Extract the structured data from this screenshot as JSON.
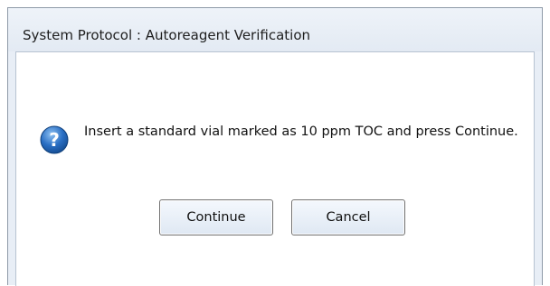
{
  "dialog": {
    "title": "System Protocol : Autoreagent Verification",
    "icon": "question-icon",
    "message": "Insert a standard vial marked as 10 ppm TOC and press Continue.",
    "buttons": {
      "continue_label": "Continue",
      "cancel_label": "Cancel"
    }
  },
  "colors": {
    "frame": "#e8eef6",
    "icon_blue": "#2a6fc4",
    "button_border": "#707070"
  }
}
